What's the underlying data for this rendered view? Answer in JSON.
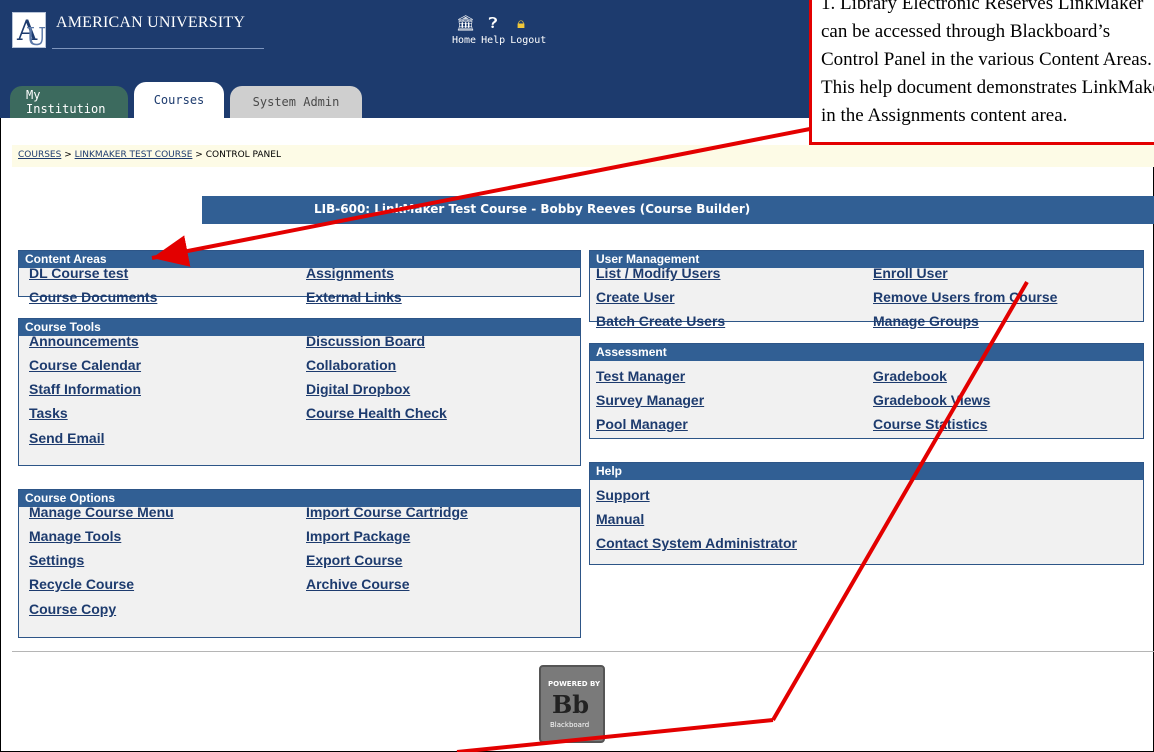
{
  "header": {
    "logo_text": "AMERICAN UNIVERSITY",
    "nav": [
      {
        "label": "Home",
        "icon": "home-icon"
      },
      {
        "label": "Help",
        "icon": "help-icon"
      },
      {
        "label": "Logout",
        "icon": "lock-icon"
      }
    ]
  },
  "tabs": [
    {
      "label": "My Institution"
    },
    {
      "label": "Courses"
    },
    {
      "label": "System Admin"
    }
  ],
  "breadcrumb": {
    "items": [
      "COURSES",
      "LINKMAKER TEST COURSE"
    ],
    "separator": ">",
    "current": "CONTROL PANEL"
  },
  "course_title": "LIB-600: LinkMaker Test Course - Bobby Reeves (Course Builder)",
  "panels": {
    "content_areas": {
      "title": "Content Areas",
      "links": [
        "DL Course test",
        "Assignments",
        "Course Documents",
        "External Links"
      ]
    },
    "course_tools": {
      "title": "Course Tools",
      "links": [
        "Announcements",
        "Discussion Board",
        "Course Calendar",
        "Collaboration",
        "Staff Information",
        "Digital Dropbox",
        "Tasks",
        "Course Health Check",
        "Send Email"
      ]
    },
    "course_options": {
      "title": "Course Options",
      "links": [
        "Manage Course Menu",
        "Import Course Cartridge",
        "Manage Tools",
        "Import Package",
        "Settings",
        "Export Course",
        "Recycle Course",
        "Archive Course",
        "Course Copy"
      ]
    },
    "user_management": {
      "title": "User Management",
      "links": [
        "List / Modify Users",
        "Enroll User",
        "Create User",
        "Remove Users from Course",
        "Batch Create Users",
        "Manage Groups"
      ]
    },
    "assessment": {
      "title": "Assessment",
      "links": [
        "Test Manager",
        "Gradebook",
        "Survey Manager",
        "Gradebook Views",
        "Pool Manager",
        "Course Statistics"
      ]
    },
    "help": {
      "title": "Help",
      "links": [
        "Support",
        "Manual",
        "Contact System Administrator"
      ]
    }
  },
  "footer": {
    "badge_top": "POWERED BY",
    "badge_mark": "Bb",
    "badge_bottom": "Blackboard"
  },
  "callout": {
    "text": "1. Library Electronic Reserves LinkMaker can be accessed through Blackboard’s Control Panel in the various Content Areas. This help document demonstrates LinkMaker in the Assignments content area."
  },
  "colors": {
    "header_bg": "#1d3b6e",
    "panel_head": "#315f94",
    "link": "#1d3b6e",
    "callout_border": "#e30000"
  }
}
